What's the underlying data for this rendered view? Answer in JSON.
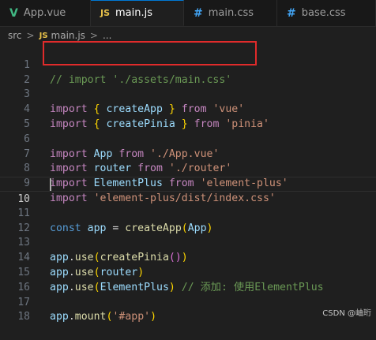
{
  "tabs": [
    {
      "icon": "V",
      "label": "App.vue",
      "active": false
    },
    {
      "icon": "JS",
      "label": "main.js",
      "active": true
    },
    {
      "icon": "#",
      "label": "main.css",
      "active": false
    },
    {
      "icon": "#",
      "label": "base.css",
      "active": false
    }
  ],
  "breadcrumb": {
    "folder": "src",
    "sep": ">",
    "file_icon": "JS",
    "file": "main.js",
    "sep2": ">",
    "more": "..."
  },
  "editor": {
    "current_line": 10,
    "lines": [
      {
        "n": "1"
      },
      {
        "n": "2"
      },
      {
        "n": "3"
      },
      {
        "n": "4"
      },
      {
        "n": "5"
      },
      {
        "n": "6"
      },
      {
        "n": "7"
      },
      {
        "n": "8"
      },
      {
        "n": "9"
      },
      {
        "n": "10"
      },
      {
        "n": "11"
      },
      {
        "n": "12"
      },
      {
        "n": "13"
      },
      {
        "n": "14"
      },
      {
        "n": "15"
      },
      {
        "n": "16"
      },
      {
        "n": "17"
      },
      {
        "n": "18"
      }
    ],
    "tokens": {
      "l1": {
        "comment": "// import './assets/main.css'"
      },
      "l3": {
        "import": "import",
        "open": " { ",
        "name": "createApp",
        "close": " } ",
        "from": "from",
        "src": " 'vue'"
      },
      "l4": {
        "import": "import",
        "open": " { ",
        "name": "createPinia",
        "close": " } ",
        "from": "from",
        "src": " 'pinia'"
      },
      "l6": {
        "import": "import",
        "name": " App ",
        "from": "from",
        "src": " './App.vue'"
      },
      "l7": {
        "import": "import",
        "name": " router ",
        "from": "from",
        "src": " './router'"
      },
      "l8": {
        "import": "import",
        "name": " ElementPlus ",
        "from": "from",
        "src": " 'element-plus'"
      },
      "l9": {
        "import": "import",
        "src": " 'element-plus/dist/index.css'"
      },
      "l11": {
        "const": "const",
        "name": " app ",
        "eq": "= ",
        "fn": "createApp",
        "p1": "(",
        "arg": "App",
        "p2": ")"
      },
      "l13": {
        "obj": "app",
        "dot": ".",
        "fn": "use",
        "p1": "(",
        "arg": "createPinia",
        "p2": "()",
        "p3": ")"
      },
      "l14": {
        "obj": "app",
        "dot": ".",
        "fn": "use",
        "p1": "(",
        "arg": "router",
        "p3": ")"
      },
      "l15": {
        "obj": "app",
        "dot": ".",
        "fn": "use",
        "p1": "(",
        "arg": "ElementPlus",
        "p3": ")",
        "comment": " // 添加: 使用ElementPlus"
      },
      "l17": {
        "obj": "app",
        "dot": ".",
        "fn": "mount",
        "p1": "(",
        "arg": "'#app'",
        "p3": ")"
      }
    }
  },
  "watermark": "CSDN @岫珩",
  "colors": {
    "keyword": "#c586c0",
    "string": "#ce9178",
    "comment": "#6a9955",
    "variable": "#9cdcfe",
    "function": "#dcdcaa",
    "highlight_box": "#e02b2b"
  }
}
